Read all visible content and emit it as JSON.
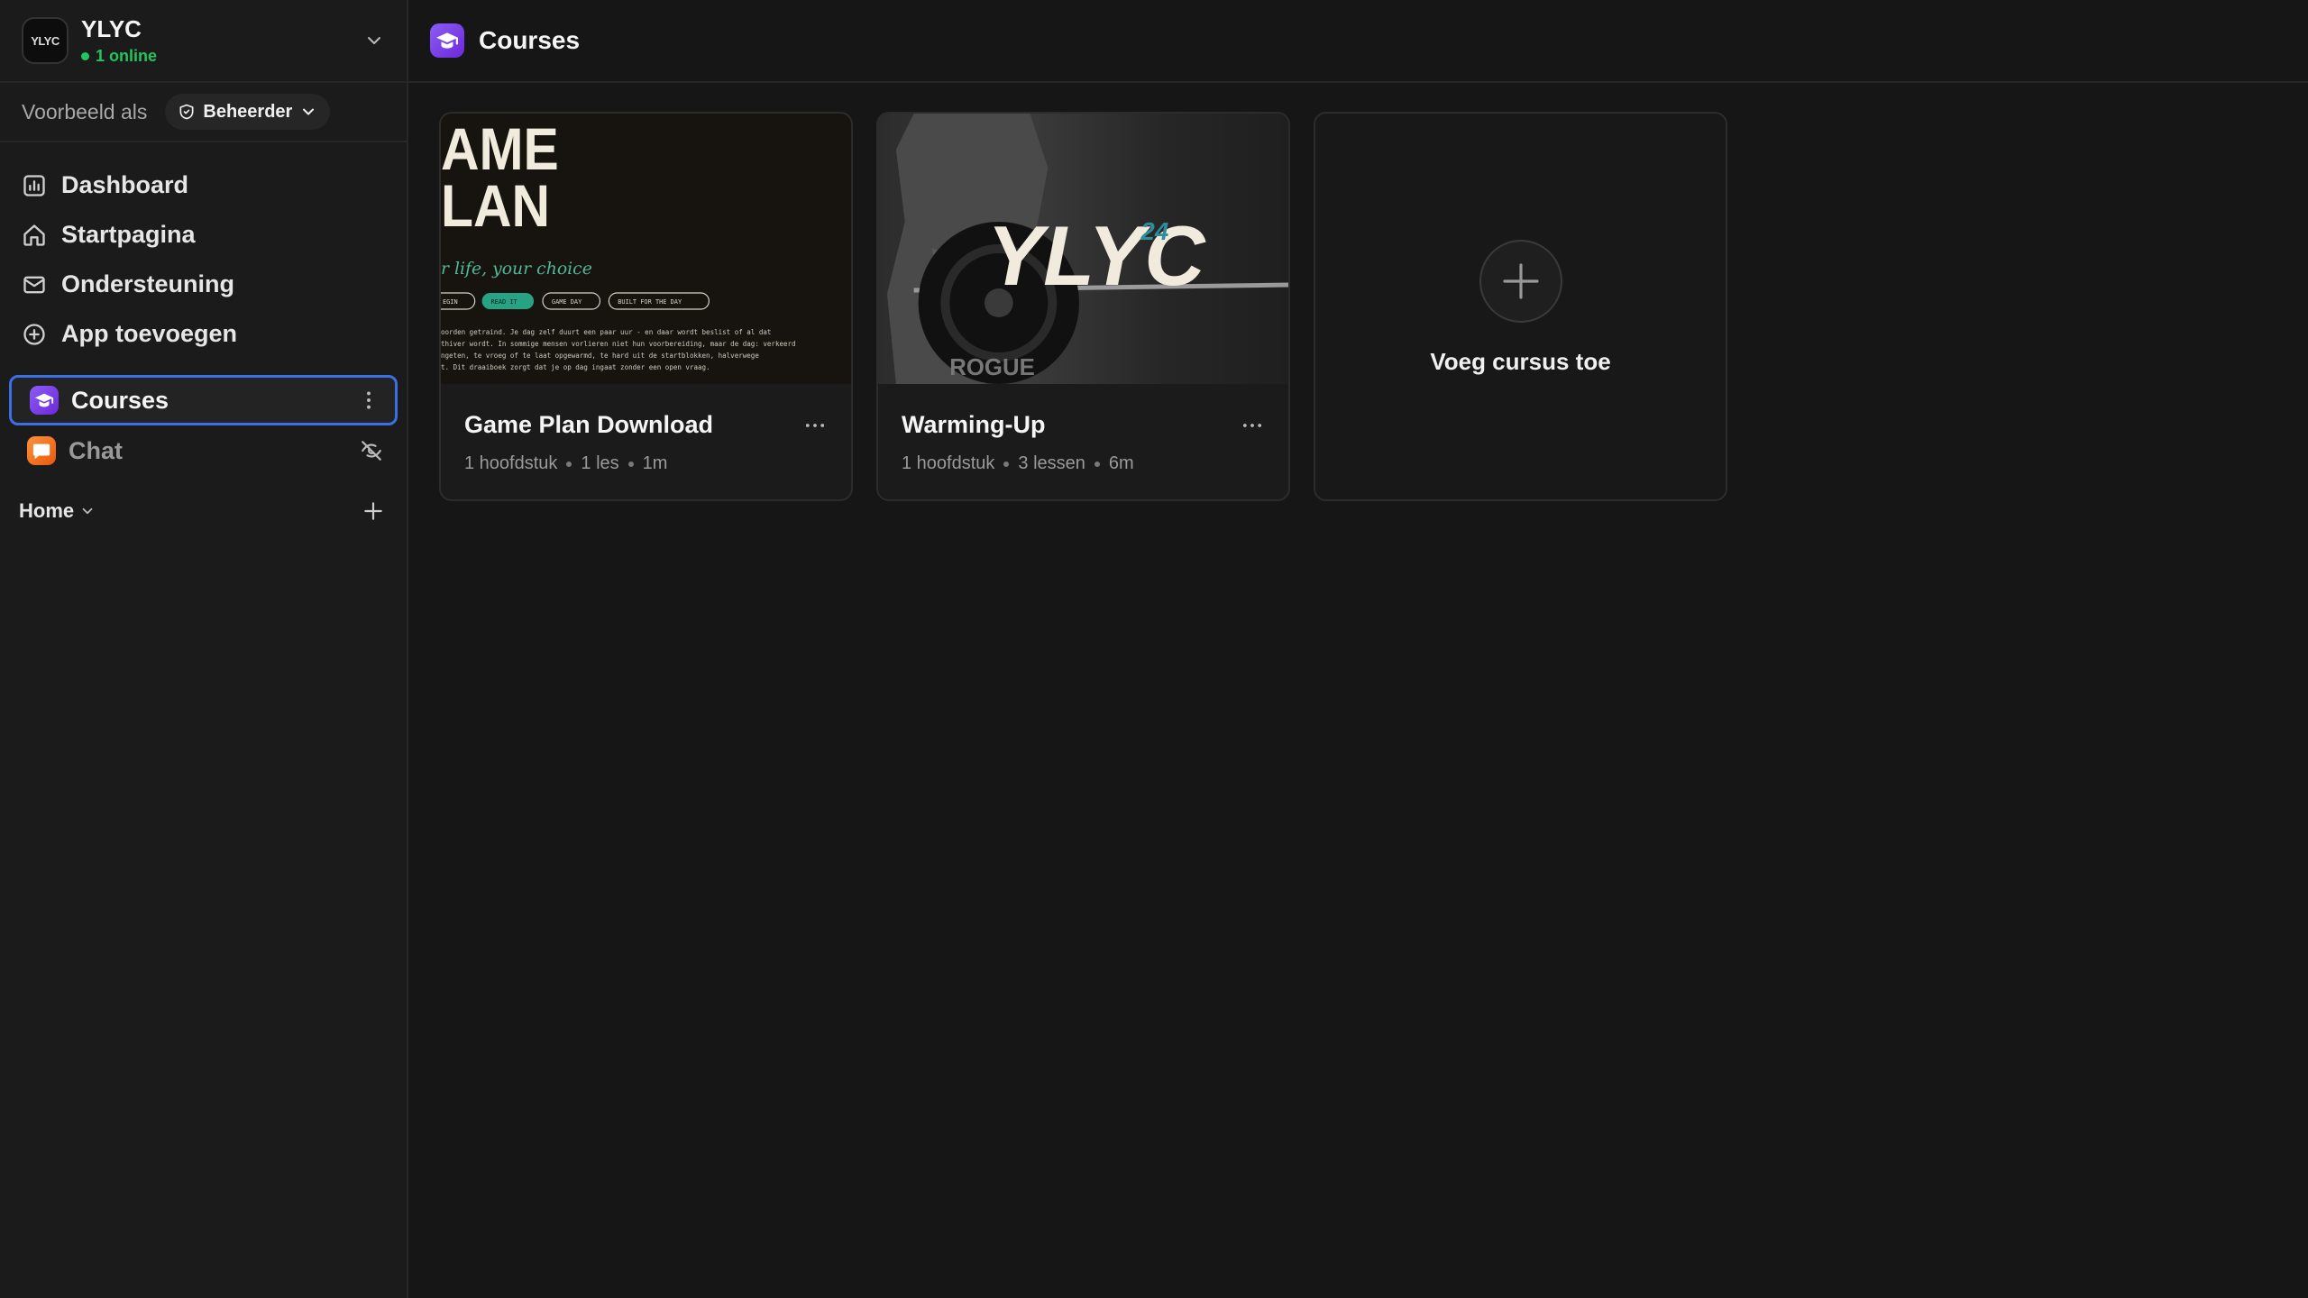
{
  "workspace": {
    "logo_text": "YLYC",
    "name": "YLYC",
    "online": "1 online"
  },
  "preview": {
    "label": "Voorbeeld als",
    "role": "Beheerder"
  },
  "nav": {
    "dashboard": "Dashboard",
    "home": "Startpagina",
    "support": "Ondersteuning",
    "add_app": "App toevoegen"
  },
  "apps": {
    "courses": "Courses",
    "chat": "Chat"
  },
  "section": {
    "label": "Home"
  },
  "page": {
    "title": "Courses"
  },
  "courses": [
    {
      "title": "Game Plan Download",
      "meta": [
        "1 hoofdstuk",
        "1 les",
        "1m"
      ],
      "thumb": {
        "heading_1": "AME",
        "heading_2": "LAN",
        "tagline": "r life, your choice",
        "pills": [
          "EGIN",
          "READ IT",
          "GAME DAY",
          "BUILT FOR THE DAY"
        ],
        "body_lines": [
          "oorden getraind. Je dag zelf duurt een paar uur - en daar wordt beslist of al dat",
          "thiver wordt. In sommige mensen vorlieren niet hun voorbereiding, maar de dag: verkeerd",
          "ngeten, te vroeg of te laat opgewarmd, te hard uit de startblokken, halverwege",
          "t. Dit draaiboek zorgt dat je op dag ingaat zonder een open vraag."
        ]
      }
    },
    {
      "title": "Warming-Up",
      "meta": [
        "1 hoofdstuk",
        "3 lessen",
        "6m"
      ],
      "thumb": {
        "logo": "YLYC",
        "superscript": "24",
        "plate_text": "ROGUE"
      }
    }
  ],
  "add_course": {
    "label": "Voeg cursus toe"
  },
  "colors": {
    "accent_border": "#3b6fe6",
    "online": "#22c55e",
    "courses_icon": "#8b5cf6",
    "chat_icon": "#f97316"
  }
}
